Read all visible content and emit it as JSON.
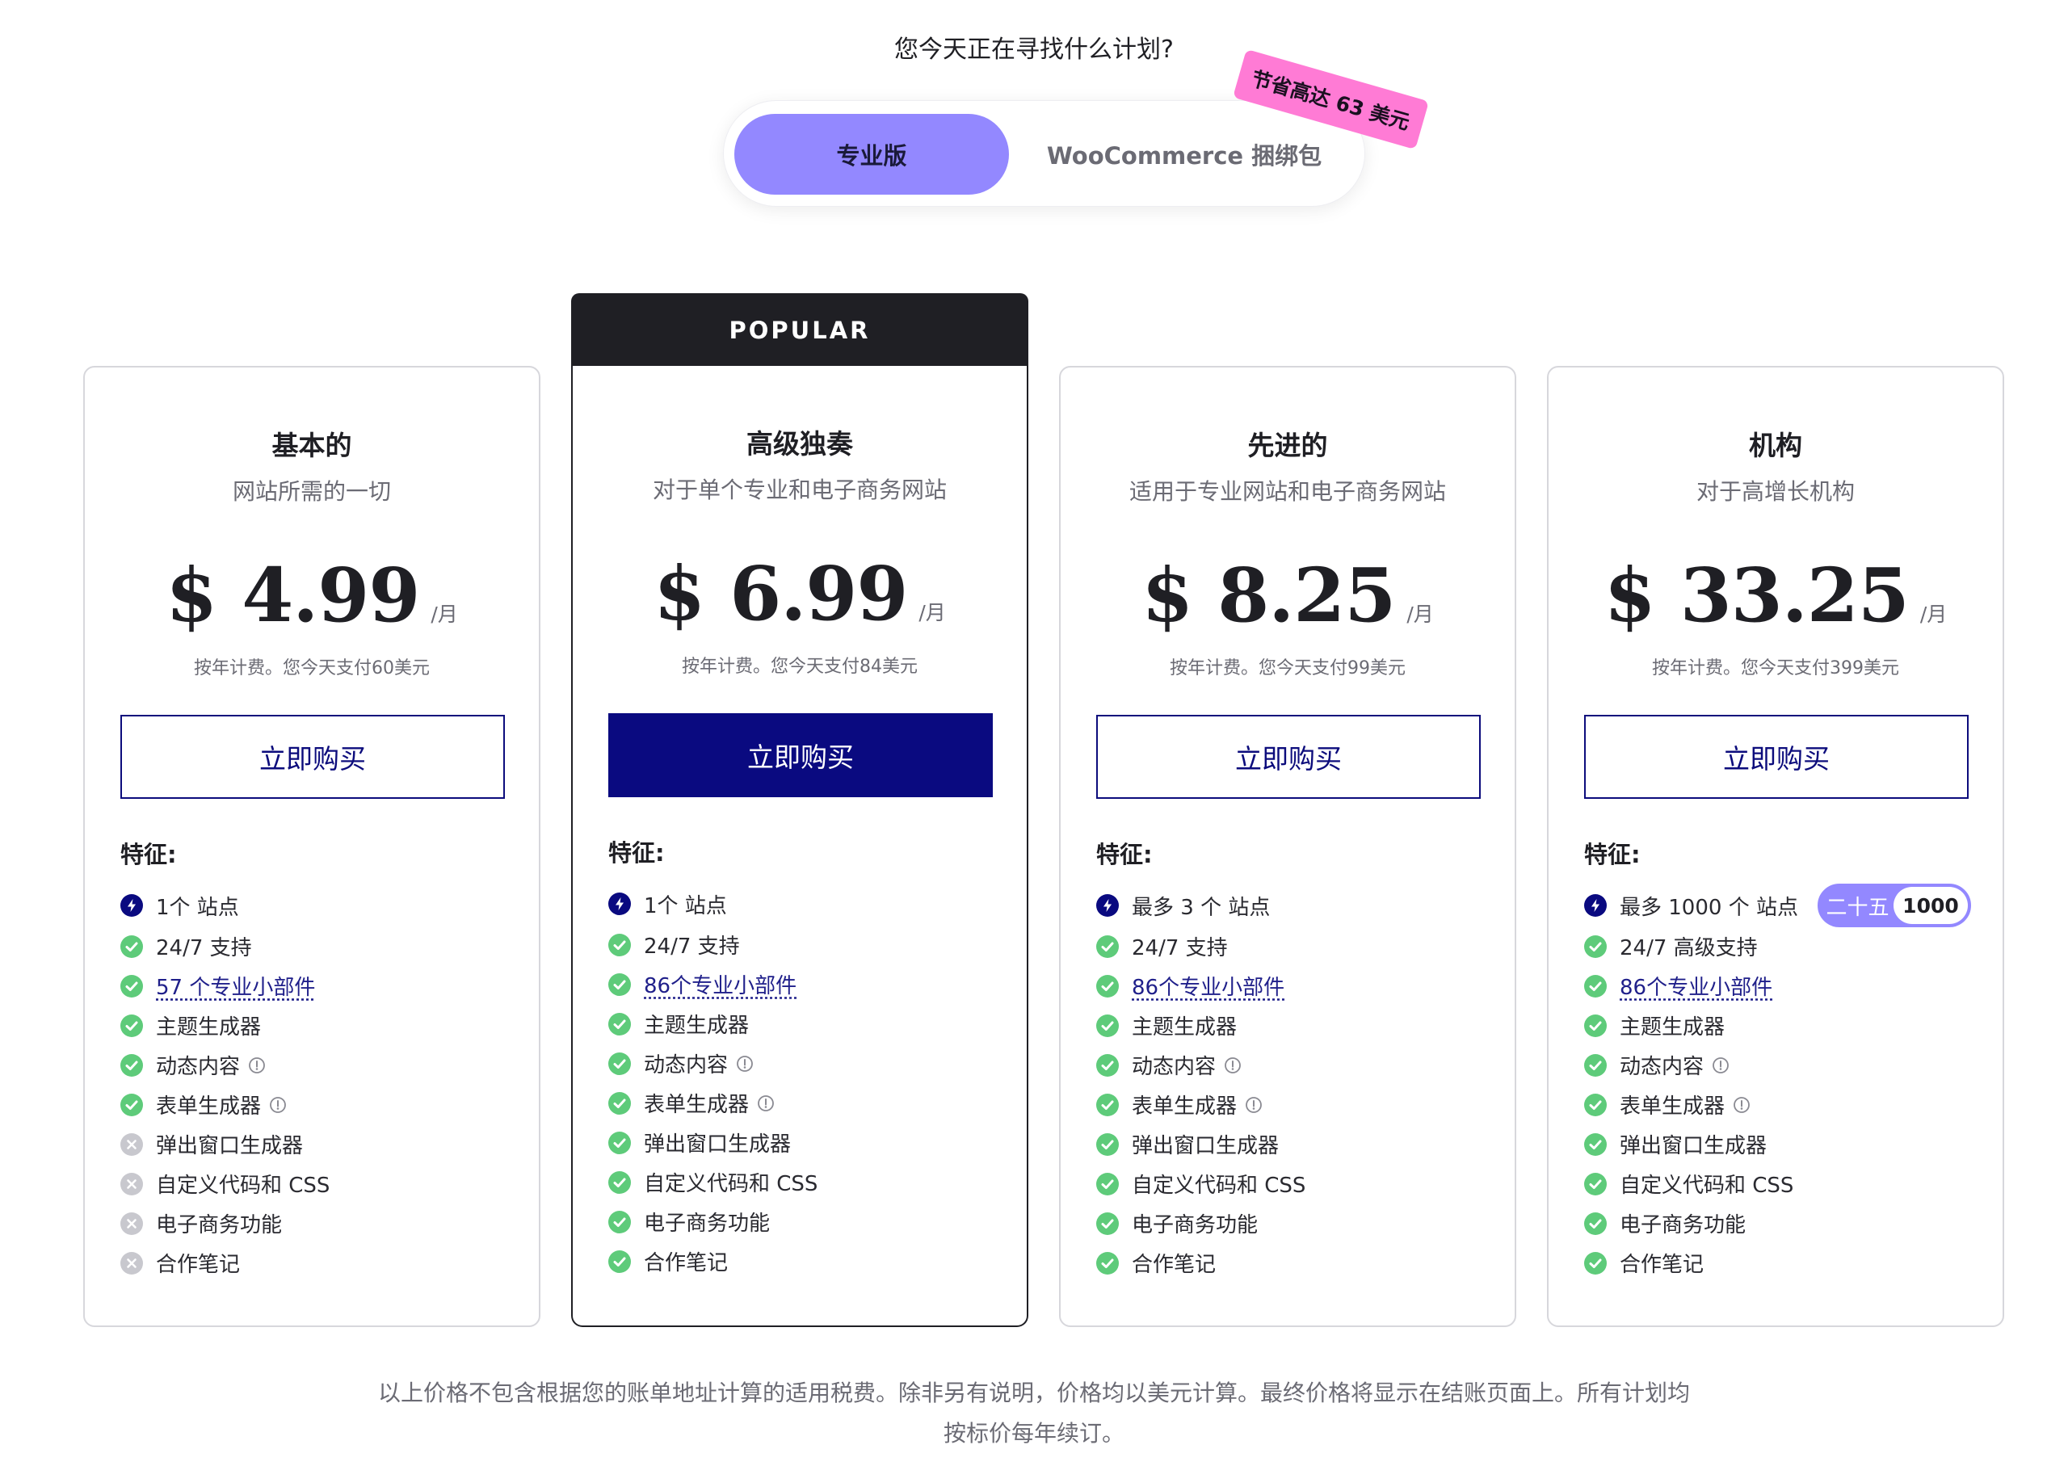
{
  "question": "您今天正在寻找什么计划?",
  "toggle": {
    "pro_label": "专业版",
    "woo_label": "WooCommerce 捆绑包",
    "save_badge": "节省高达 63 美元"
  },
  "popular_label": "POPULAR",
  "plans": [
    {
      "name": "基本的",
      "desc": "网站所需的一切",
      "price": "$ 4.99",
      "per": "/月",
      "billing": "按年计费。您今天支付60美元",
      "buy": "立即购买",
      "features_label": "特征:",
      "sites": "1个 站点",
      "support": "24/7 支持",
      "widgets": "57 个专业小部件",
      "theme_builder": "主题生成器",
      "dynamic": "动态内容",
      "form": "表单生成器",
      "popup": "弹出窗口生成器",
      "css": "自定义代码和 CSS",
      "ecom": "电子商务功能",
      "notes": "合作笔记"
    },
    {
      "name": "高级独奏",
      "desc": "对于单个专业和电子商务网站",
      "price": "$ 6.99",
      "per": "/月",
      "billing": "按年计费。您今天支付84美元",
      "buy": "立即购买",
      "features_label": "特征:",
      "sites": "1个 站点",
      "support": "24/7 支持",
      "widgets": "86个专业小部件",
      "theme_builder": "主题生成器",
      "dynamic": "动态内容",
      "form": "表单生成器",
      "popup": "弹出窗口生成器",
      "css": "自定义代码和 CSS",
      "ecom": "电子商务功能",
      "notes": "合作笔记"
    },
    {
      "name": "先进的",
      "desc": "适用于专业网站和电子商务网站",
      "price": "$ 8.25",
      "per": "/月",
      "billing": "按年计费。您今天支付99美元",
      "buy": "立即购买",
      "features_label": "特征:",
      "sites": "最多 3 个 站点",
      "support": "24/7 支持",
      "widgets": "86个专业小部件",
      "theme_builder": "主题生成器",
      "dynamic": "动态内容",
      "form": "表单生成器",
      "popup": "弹出窗口生成器",
      "css": "自定义代码和 CSS",
      "ecom": "电子商务功能",
      "notes": "合作笔记"
    },
    {
      "name": "机构",
      "desc": "对于高增长机构",
      "price": "$ 33.25",
      "per": "/月",
      "billing": "按年计费。您今天支付399美元",
      "buy": "立即购买",
      "features_label": "特征:",
      "sites": "最多 1000 个 站点",
      "sites_opt_a": "二十五",
      "sites_opt_b": "1000",
      "support": "24/7 高级支持",
      "widgets": "86个专业小部件",
      "theme_builder": "主题生成器",
      "dynamic": "动态内容",
      "form": "表单生成器",
      "popup": "弹出窗口生成器",
      "css": "自定义代码和 CSS",
      "ecom": "电子商务功能",
      "notes": "合作笔记"
    }
  ],
  "footnote_line1": "以上价格不包含根据您的账单地址计算的适用税费。除非另有说明，价格均以美元计算。最终价格将显示在结账页面上。所有计划均",
  "footnote_line2": "按标价每年续订。",
  "colors": {
    "accent_purple": "#9388ff",
    "navy": "#0a0a80",
    "check_green": "#5ecb7a",
    "badge_pink": "#ff7bd5",
    "disabled_gray": "#c8c8ce"
  }
}
